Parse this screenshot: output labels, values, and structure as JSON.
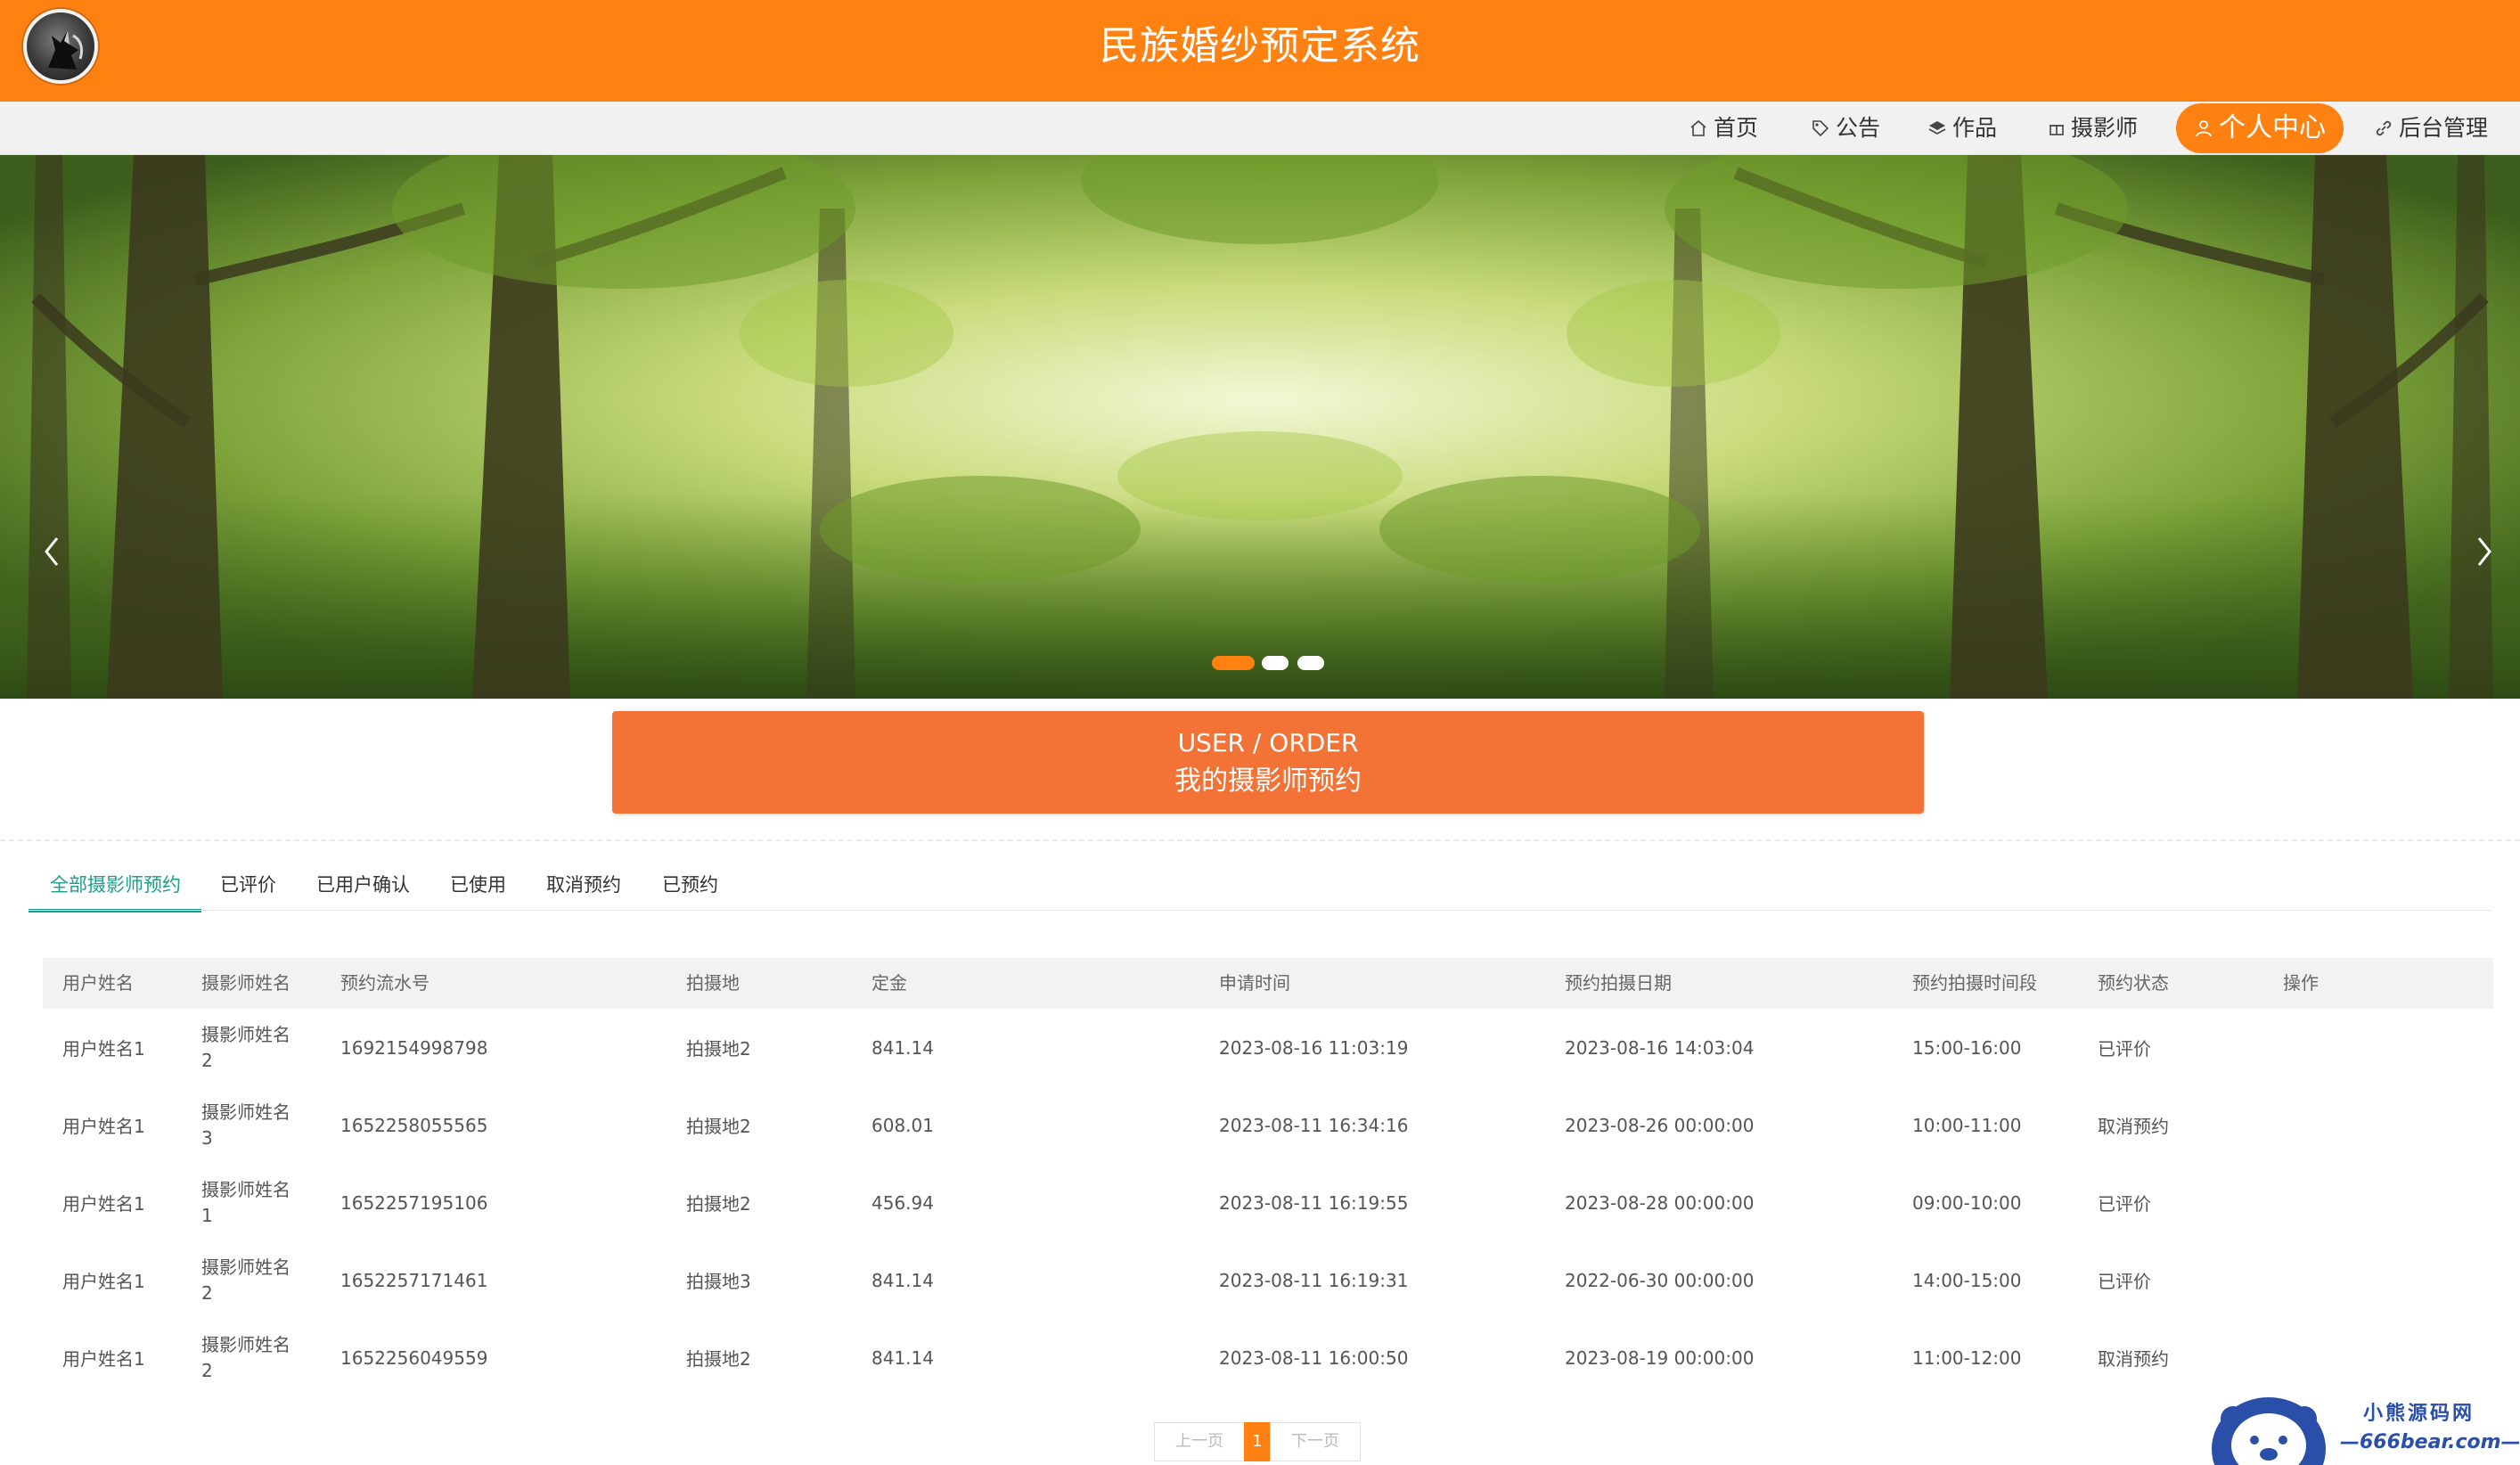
{
  "header": {
    "title": "民族婚纱预定系统",
    "logo_icon": "wolf-logo-icon"
  },
  "nav": {
    "items": [
      {
        "label": "首页",
        "icon": "home-icon"
      },
      {
        "label": "公告",
        "icon": "tag-icon"
      },
      {
        "label": "作品",
        "icon": "layers-icon"
      },
      {
        "label": "摄影师",
        "icon": "gift-icon"
      },
      {
        "label": "个人中心",
        "icon": "user-icon",
        "active": true
      },
      {
        "label": "后台管理",
        "icon": "link-icon"
      }
    ]
  },
  "banner": {
    "slide_count": 3,
    "active_slide": 1
  },
  "section": {
    "title_en": "USER / ORDER",
    "title_cn": "我的摄影师预约"
  },
  "tabs": [
    {
      "label": "全部摄影师预约",
      "active": true
    },
    {
      "label": "已评价"
    },
    {
      "label": "已用户确认"
    },
    {
      "label": "已使用"
    },
    {
      "label": "取消预约"
    },
    {
      "label": "已预约"
    }
  ],
  "table": {
    "columns": [
      "用户姓名",
      "摄影师姓名",
      "预约流水号",
      "拍摄地",
      "定金",
      "申请时间",
      "预约拍摄日期",
      "预约拍摄时间段",
      "预约状态",
      "操作"
    ],
    "rows": [
      [
        "用户姓名1",
        "摄影师姓名2",
        "1692154998798",
        "拍摄地2",
        "841.14",
        "2023-08-16 11:03:19",
        "2023-08-16 14:03:04",
        "15:00-16:00",
        "已评价",
        ""
      ],
      [
        "用户姓名1",
        "摄影师姓名3",
        "1652258055565",
        "拍摄地2",
        "608.01",
        "2023-08-11 16:34:16",
        "2023-08-26 00:00:00",
        "10:00-11:00",
        "取消预约",
        ""
      ],
      [
        "用户姓名1",
        "摄影师姓名1",
        "1652257195106",
        "拍摄地2",
        "456.94",
        "2023-08-11 16:19:55",
        "2023-08-28 00:00:00",
        "09:00-10:00",
        "已评价",
        ""
      ],
      [
        "用户姓名1",
        "摄影师姓名2",
        "1652257171461",
        "拍摄地3",
        "841.14",
        "2023-08-11 16:19:31",
        "2022-06-30 00:00:00",
        "14:00-15:00",
        "已评价",
        ""
      ],
      [
        "用户姓名1",
        "摄影师姓名2",
        "1652256049559",
        "拍摄地2",
        "841.14",
        "2023-08-11 16:00:50",
        "2023-08-19 00:00:00",
        "11:00-12:00",
        "取消预约",
        ""
      ]
    ]
  },
  "pagination": {
    "prev": "上一页",
    "current": "1",
    "next": "下一页"
  },
  "watermark": {
    "line1": "小熊源码网",
    "line2": "—666bear.com—"
  },
  "colors": {
    "brand": "#ff8112",
    "section": "#f37337",
    "tab_active": "#1aa08a"
  }
}
